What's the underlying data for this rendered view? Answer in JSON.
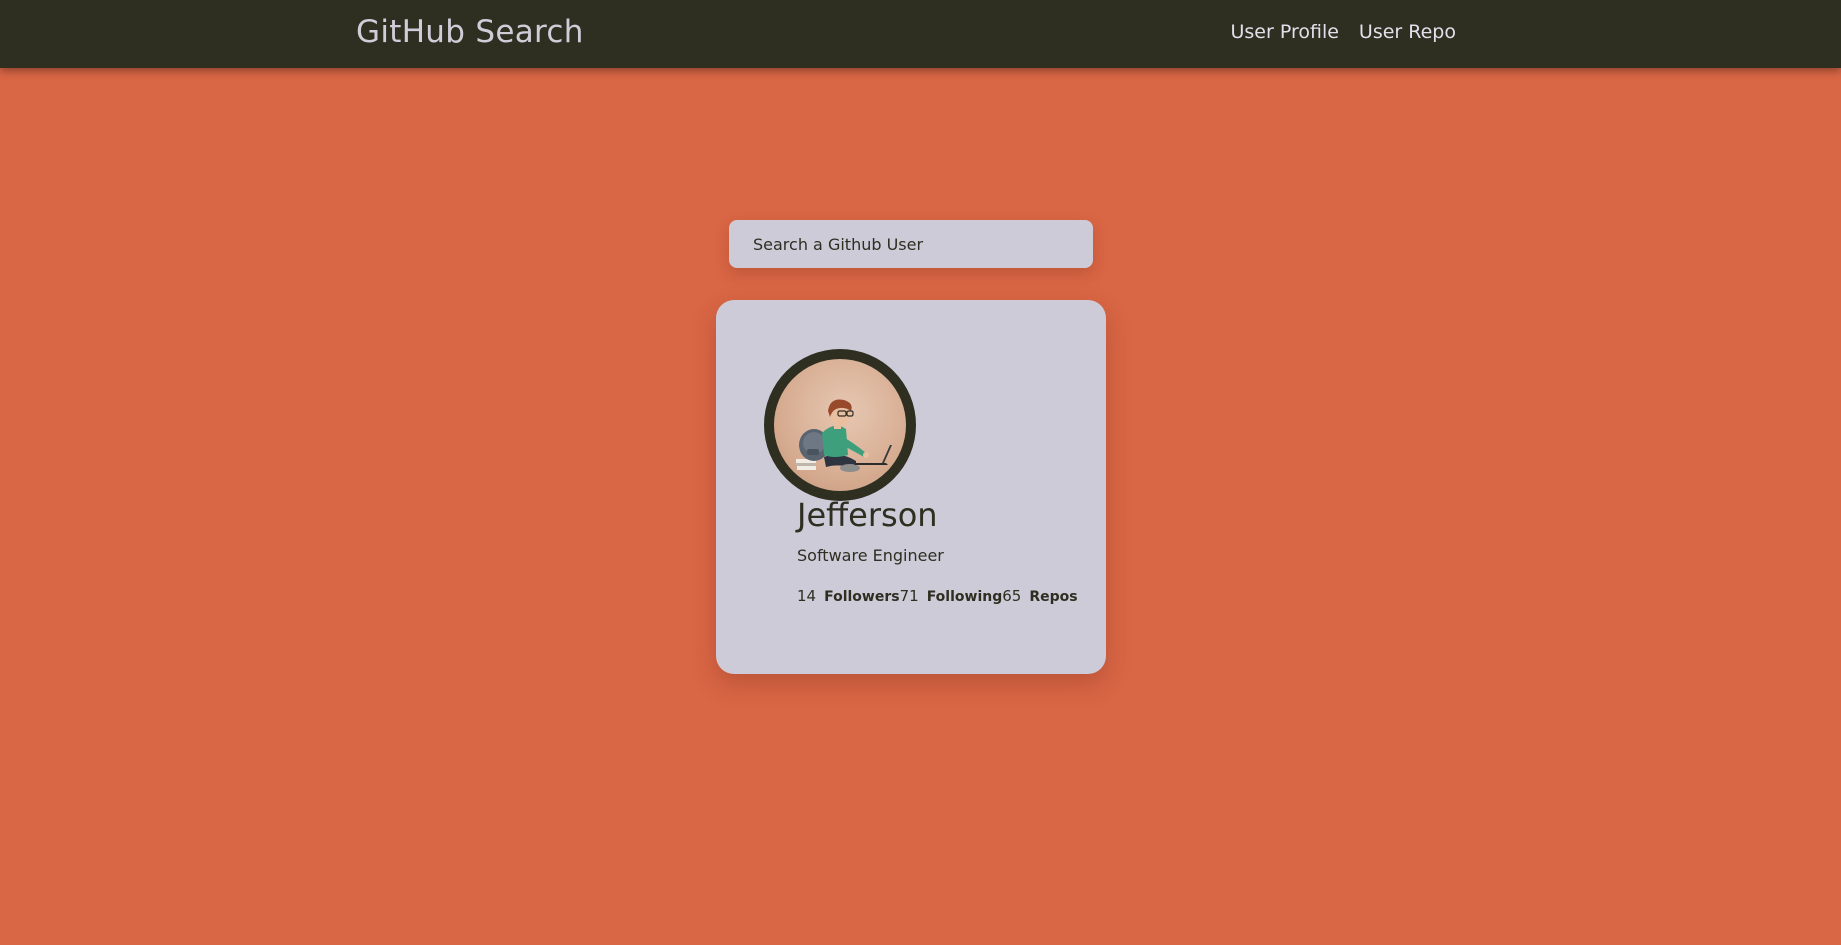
{
  "navbar": {
    "brand": "GitHub Search",
    "links": [
      "User Profile",
      "User Repo"
    ]
  },
  "search": {
    "placeholder": "Search a Github User",
    "value": ""
  },
  "profile": {
    "avatar_icon": "developer-illustration-avatar",
    "name": "Jefferson",
    "bio": "Software Engineer",
    "stats": {
      "followers": {
        "count": "14",
        "label": "Followers"
      },
      "following": {
        "count": "71",
        "label": "Following"
      },
      "repos": {
        "count": "65",
        "label": "Repos"
      }
    }
  },
  "colors": {
    "background": "#d96645",
    "navbar": "#2e2e21",
    "card": "#cdcbd8",
    "text_dark": "#2e2e21",
    "text_light": "#cfcdd8"
  }
}
